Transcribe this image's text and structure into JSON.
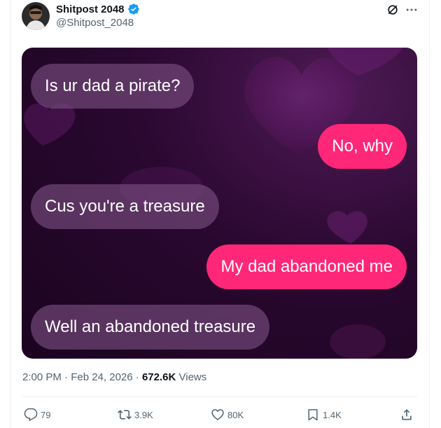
{
  "author": {
    "display_name": "Shitpost 2048",
    "handle": "@Shitpost_2048",
    "verified": true,
    "verified_color": "#1d9bf0"
  },
  "header_icons": [
    "grok-icon",
    "more-icon"
  ],
  "media": {
    "messages": [
      {
        "side": "received",
        "text": "Is ur dad a pirate?"
      },
      {
        "side": "sent",
        "text": "No, why"
      },
      {
        "side": "received",
        "text": "Cus you're a treasure"
      },
      {
        "side": "sent",
        "text": "My dad abandoned me"
      },
      {
        "side": "received",
        "text": "Well an abandoned treasure"
      }
    ],
    "sent_color": "#ff2777",
    "background_color": "#2a0830"
  },
  "meta": {
    "time": "2:00 PM",
    "separator": "·",
    "date": "Feb 24, 2026",
    "views_count": "672.6K",
    "views_label": "Views"
  },
  "actions": {
    "replies": "79",
    "reposts": "3.9K",
    "likes": "80K",
    "bookmarks": "1.4K"
  }
}
